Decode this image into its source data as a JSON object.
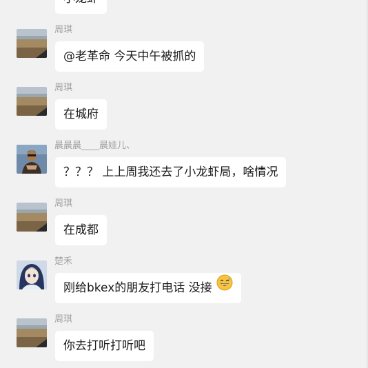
{
  "messages": [
    {
      "sender": "",
      "text": "小龙虾",
      "avatar": "landscape"
    },
    {
      "sender": "周琪",
      "text": "@老革命 今天中午被抓的",
      "avatar": "landscape"
    },
    {
      "sender": "周琪",
      "text": "在城府",
      "avatar": "landscape"
    },
    {
      "sender": "晨晨晨____晨娃儿、",
      "text": "？？？ 上上周我还去了小龙虾局，啥情况",
      "avatar": "person"
    },
    {
      "sender": "周琪",
      "text": "在成都",
      "avatar": "landscape"
    },
    {
      "sender": "楚禾",
      "text": "刚给bkex的朋友打电话 没接",
      "emoji": "grinning-sweat-emoji",
      "avatar": "anime"
    },
    {
      "sender": "周琪",
      "text": "你去打听打听吧",
      "avatar": "landscape"
    }
  ],
  "colors": {
    "background": "#f1f1f1",
    "bubble": "#ffffff",
    "sender_name": "#a0a0a0",
    "message_text": "#1a1a1a"
  }
}
